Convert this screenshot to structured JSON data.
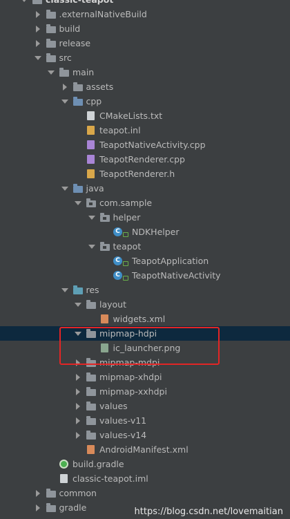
{
  "tree": [
    {
      "label": "classic-teapot",
      "depth": 0,
      "arrow": "open",
      "icon": "folder",
      "bold": true
    },
    {
      "label": ".externalNativeBuild",
      "depth": 1,
      "arrow": "closed",
      "icon": "folder"
    },
    {
      "label": "build",
      "depth": 1,
      "arrow": "closed",
      "icon": "folder"
    },
    {
      "label": "release",
      "depth": 1,
      "arrow": "closed",
      "icon": "folder"
    },
    {
      "label": "src",
      "depth": 1,
      "arrow": "open",
      "icon": "folder"
    },
    {
      "label": "main",
      "depth": 2,
      "arrow": "open",
      "icon": "folder"
    },
    {
      "label": "assets",
      "depth": 3,
      "arrow": "closed",
      "icon": "folder"
    },
    {
      "label": "cpp",
      "depth": 3,
      "arrow": "open",
      "icon": "folder-blue"
    },
    {
      "label": "CMakeLists.txt",
      "depth": 4,
      "arrow": "none",
      "icon": "file"
    },
    {
      "label": "teapot.inl",
      "depth": 4,
      "arrow": "none",
      "icon": "file-h"
    },
    {
      "label": "TeapotNativeActivity.cpp",
      "depth": 4,
      "arrow": "none",
      "icon": "file-cpp"
    },
    {
      "label": "TeapotRenderer.cpp",
      "depth": 4,
      "arrow": "none",
      "icon": "file-cpp"
    },
    {
      "label": "TeapotRenderer.h",
      "depth": 4,
      "arrow": "none",
      "icon": "file-h"
    },
    {
      "label": "java",
      "depth": 3,
      "arrow": "open",
      "icon": "folder-blue"
    },
    {
      "label": "com.sample",
      "depth": 4,
      "arrow": "open",
      "icon": "package"
    },
    {
      "label": "helper",
      "depth": 5,
      "arrow": "open",
      "icon": "package"
    },
    {
      "label": "NDKHelper",
      "depth": 6,
      "arrow": "none",
      "icon": "class"
    },
    {
      "label": "teapot",
      "depth": 5,
      "arrow": "open",
      "icon": "package"
    },
    {
      "label": "TeapotApplication",
      "depth": 6,
      "arrow": "none",
      "icon": "class"
    },
    {
      "label": "TeapotNativeActivity",
      "depth": 6,
      "arrow": "none",
      "icon": "class"
    },
    {
      "label": "res",
      "depth": 3,
      "arrow": "open",
      "icon": "folder-cyan"
    },
    {
      "label": "layout",
      "depth": 4,
      "arrow": "open",
      "icon": "folder"
    },
    {
      "label": "widgets.xml",
      "depth": 5,
      "arrow": "none",
      "icon": "file-xml"
    },
    {
      "label": "mipmap-hdpi",
      "depth": 4,
      "arrow": "open",
      "icon": "folder",
      "selected": true
    },
    {
      "label": "ic_launcher.png",
      "depth": 5,
      "arrow": "none",
      "icon": "file-png"
    },
    {
      "label": "mipmap-mdpi",
      "depth": 4,
      "arrow": "closed",
      "icon": "folder"
    },
    {
      "label": "mipmap-xhdpi",
      "depth": 4,
      "arrow": "closed",
      "icon": "folder"
    },
    {
      "label": "mipmap-xxhdpi",
      "depth": 4,
      "arrow": "closed",
      "icon": "folder"
    },
    {
      "label": "values",
      "depth": 4,
      "arrow": "closed",
      "icon": "folder"
    },
    {
      "label": "values-v11",
      "depth": 4,
      "arrow": "closed",
      "icon": "folder"
    },
    {
      "label": "values-v14",
      "depth": 4,
      "arrow": "closed",
      "icon": "folder"
    },
    {
      "label": "AndroidManifest.xml",
      "depth": 4,
      "arrow": "none",
      "icon": "file-xml"
    },
    {
      "label": "build.gradle",
      "depth": 2,
      "arrow": "none",
      "icon": "gradle"
    },
    {
      "label": "classic-teapot.iml",
      "depth": 2,
      "arrow": "none",
      "icon": "file"
    },
    {
      "label": "common",
      "depth": 1,
      "arrow": "closed",
      "icon": "folder"
    },
    {
      "label": "gradle",
      "depth": 1,
      "arrow": "closed",
      "icon": "folder"
    }
  ],
  "watermark": "https://blog.csdn.net/lovemaitian"
}
